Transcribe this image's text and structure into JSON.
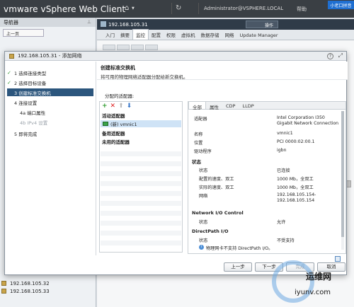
{
  "app": {
    "brand": "vmware vSphere Web Client",
    "user": "Administrator@VSPHERE.LOCAL",
    "help": "帮助",
    "ime": "小老口拼音"
  },
  "navigator": {
    "title": "导航器",
    "back": "上一页",
    "hosts": [
      "192.168.105.32",
      "192.168.105.33"
    ]
  },
  "main": {
    "host": "192.168.105.31",
    "actions": "操作",
    "tabs": [
      "入门",
      "摘要",
      "监控",
      "配置",
      "权限",
      "虚拟机",
      "数据存储",
      "网络",
      "Update Manager"
    ],
    "active_tab": "监控"
  },
  "dialog": {
    "title": "192.168.105.31 - 添加网络",
    "help_icon": "?",
    "steps": [
      {
        "label": "1  选择连接类型",
        "state": "done"
      },
      {
        "label": "2  选择目标设备",
        "state": "done"
      },
      {
        "label": "3  创建标准交换机",
        "state": "current"
      },
      {
        "label": "4  连接设置",
        "state": "normal"
      },
      {
        "label": "4a  端口属性",
        "state": "sub"
      },
      {
        "label": "4b  IPv4 设置",
        "state": "sub-disabled"
      },
      {
        "label": "5  即将完成",
        "state": "normal"
      }
    ],
    "content": {
      "title": "创建标准交换机",
      "subtitle": "将可用的物理网络适配器分配给新交换机。",
      "assigned_label": "分配的适配器:",
      "sections": {
        "active": "活动适配器",
        "standby": "备用适配器",
        "unused": "未用的适配器"
      },
      "adapter": "(新) vmnic1"
    },
    "details": {
      "tabs": [
        "全部",
        "属性",
        "CDP",
        "LLDP"
      ],
      "active_tab": "全部",
      "rows": [
        {
          "k": "适配器",
          "v": "Intel Corporation I350 Gigabit Network Connection"
        },
        {
          "k": "名称",
          "v": "vmnic1"
        },
        {
          "k": "位置",
          "v": "PCI 0000:02:00.1"
        },
        {
          "k": "驱动程序",
          "v": "igbn"
        }
      ],
      "status_title": "状态",
      "status_rows": [
        {
          "k": "状态",
          "v": "已连接"
        },
        {
          "k": "配置的速度、双工",
          "v": "1000 Mb，全双工"
        },
        {
          "k": "实际的速度、双工",
          "v": "1000 Mb，全双工"
        },
        {
          "k": "网络",
          "v": "192.168.105.154-192.168.105.154"
        }
      ],
      "nioc_title": "Network I/O Control",
      "nioc_status_k": "状态",
      "nioc_status_v": "允许",
      "dpio_title": "DirectPath I/O",
      "dpio_status_k": "状态",
      "dpio_status_v": "不受支持",
      "dpio_note": "物理网卡不支持 DirectPath I/O。"
    },
    "buttons": {
      "back": "上一步",
      "next": "下一步",
      "finish": "完成",
      "cancel": "取消"
    }
  },
  "watermark": {
    "cn": "运维网",
    "en": "iyunv.com"
  }
}
